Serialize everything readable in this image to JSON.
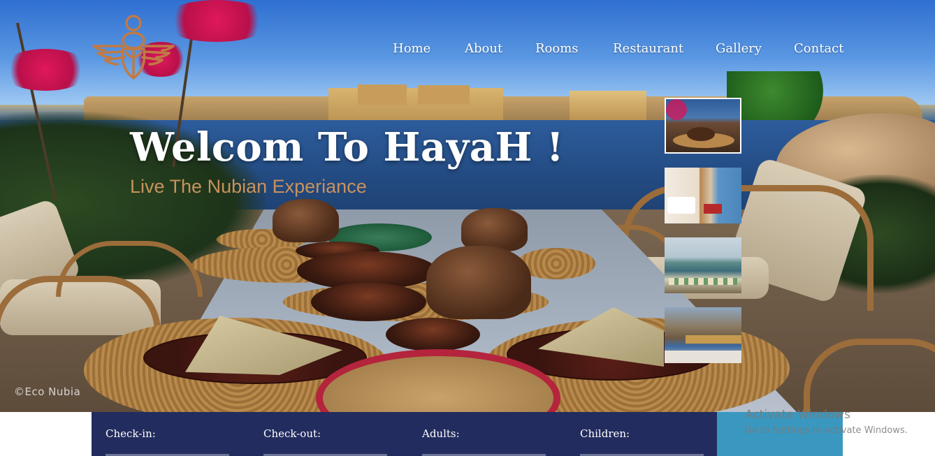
{
  "nav": {
    "items": [
      {
        "label": "Home"
      },
      {
        "label": "About"
      },
      {
        "label": "Rooms"
      },
      {
        "label": "Restaurant"
      },
      {
        "label": "Gallery"
      },
      {
        "label": "Contact"
      }
    ]
  },
  "hero": {
    "title": "Welcom To HayaH !",
    "subtitle": "Live The Nubian Experiance",
    "watermark": "©Eco Nubia"
  },
  "thumbnails": [
    {
      "icon": "dining-terrace-thumbnail",
      "active": true
    },
    {
      "icon": "hotel-room-thumbnail",
      "active": false
    },
    {
      "icon": "river-pool-thumbnail",
      "active": false
    },
    {
      "icon": "rooftop-view-thumbnail",
      "active": false
    }
  ],
  "booking": {
    "checkin_label": "Check-in:",
    "checkout_label": "Check-out:",
    "adults_label": "Adults:",
    "children_label": "Children:"
  },
  "windows_notice": {
    "title": "Activate Windows",
    "subtitle": "Go to Settings to activate Windows."
  },
  "colors": {
    "booking_bar": "#232c5e",
    "book_button": "#3a98c0",
    "accent_subtitle": "#c9925d",
    "logo": "#c07a45"
  }
}
